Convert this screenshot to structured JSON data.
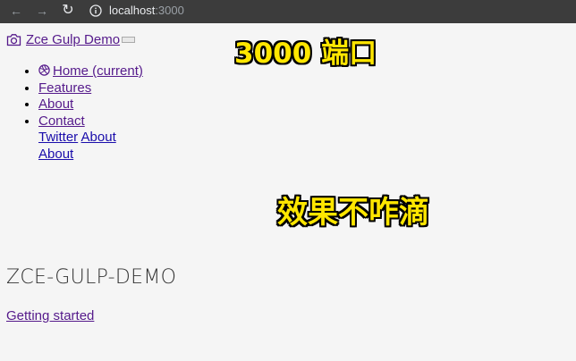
{
  "browser": {
    "url_host": "localhost",
    "url_port": ":3000",
    "back_glyph": "←",
    "forward_glyph": "→",
    "reload_glyph": "↻"
  },
  "navbar": {
    "brand_label": "Zce Gulp Demo"
  },
  "menu": {
    "items": [
      {
        "label": "Home (current)"
      },
      {
        "label": "Features"
      },
      {
        "label": "About"
      },
      {
        "label": "Contact"
      }
    ]
  },
  "footer_links": {
    "row1": [
      "Twitter",
      "About"
    ],
    "row2": [
      "About"
    ]
  },
  "hero": {
    "title": "ZCE-GULP-DEMO",
    "cta_label": "Getting started"
  },
  "overlay": {
    "port_caption": "3000 端口",
    "effect_caption": "效果不咋滴"
  },
  "colors": {
    "caption_fill": "#ffe600",
    "visited_link": "#551a8b",
    "link": "#1a0dab"
  }
}
